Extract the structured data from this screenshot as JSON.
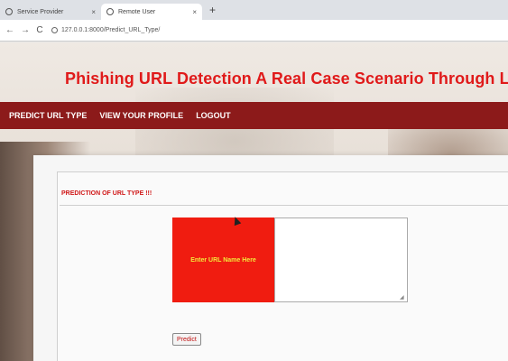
{
  "browser": {
    "tabs": [
      {
        "label": "Service Provider",
        "close": "×"
      },
      {
        "label": "Remote User",
        "close": "×"
      }
    ],
    "new_tab": "+",
    "back": "←",
    "forward": "→",
    "reload": "C",
    "url": "127.0.0.1:8000/Predict_URL_Type/"
  },
  "site": {
    "title": "Phishing URL Detection A Real Case Scenario Through Login URLs",
    "nav": [
      "PREDICT URL TYPE",
      "VIEW YOUR PROFILE",
      "LOGOUT"
    ]
  },
  "form": {
    "section_title": "PREDICTION OF URL TYPE !!!",
    "url_label": "Enter URL Name Here",
    "url_value": "",
    "predict_button": "Predict"
  },
  "colors": {
    "accent": "#e01a1a",
    "nav_bg": "#8c1a1a",
    "label_bg": "#f01c10",
    "label_text": "#f2e83a"
  }
}
